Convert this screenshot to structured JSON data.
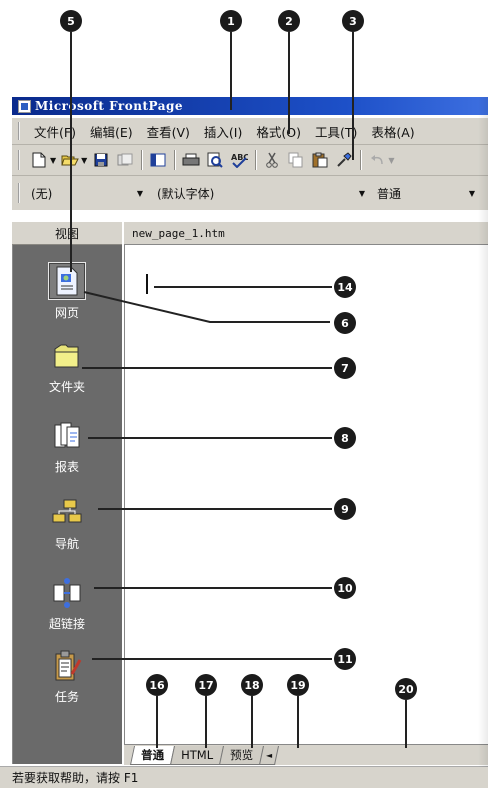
{
  "title": "Microsoft FrontPage",
  "menu": [
    "文件(F)",
    "编辑(E)",
    "查看(V)",
    "插入(I)",
    "格式(O)",
    "工具(T)",
    "表格(A)"
  ],
  "formatting": {
    "style": "(无)",
    "font": "(默认字体)",
    "size": "普通"
  },
  "views": {
    "header": "视图",
    "items": [
      {
        "label": "网页",
        "icon": "page-view-icon"
      },
      {
        "label": "文件夹",
        "icon": "folder-icon"
      },
      {
        "label": "报表",
        "icon": "reports-icon"
      },
      {
        "label": "导航",
        "icon": "navigation-icon"
      },
      {
        "label": "超链接",
        "icon": "hyperlinks-icon"
      },
      {
        "label": "任务",
        "icon": "tasks-icon"
      }
    ]
  },
  "document": {
    "tab": "new_page_1.htm"
  },
  "bottom_tabs": [
    "普通",
    "HTML",
    "预览"
  ],
  "status": "若要获取帮助，请按 F1",
  "callouts": [
    "1",
    "2",
    "3",
    "5",
    "6",
    "7",
    "8",
    "9",
    "10",
    "11",
    "14",
    "16",
    "17",
    "18",
    "19",
    "20"
  ],
  "colors": {
    "titlebar": "#0a2a8c",
    "viewsbar": "#6a6a6a",
    "chrome": "#d7d4cc"
  }
}
